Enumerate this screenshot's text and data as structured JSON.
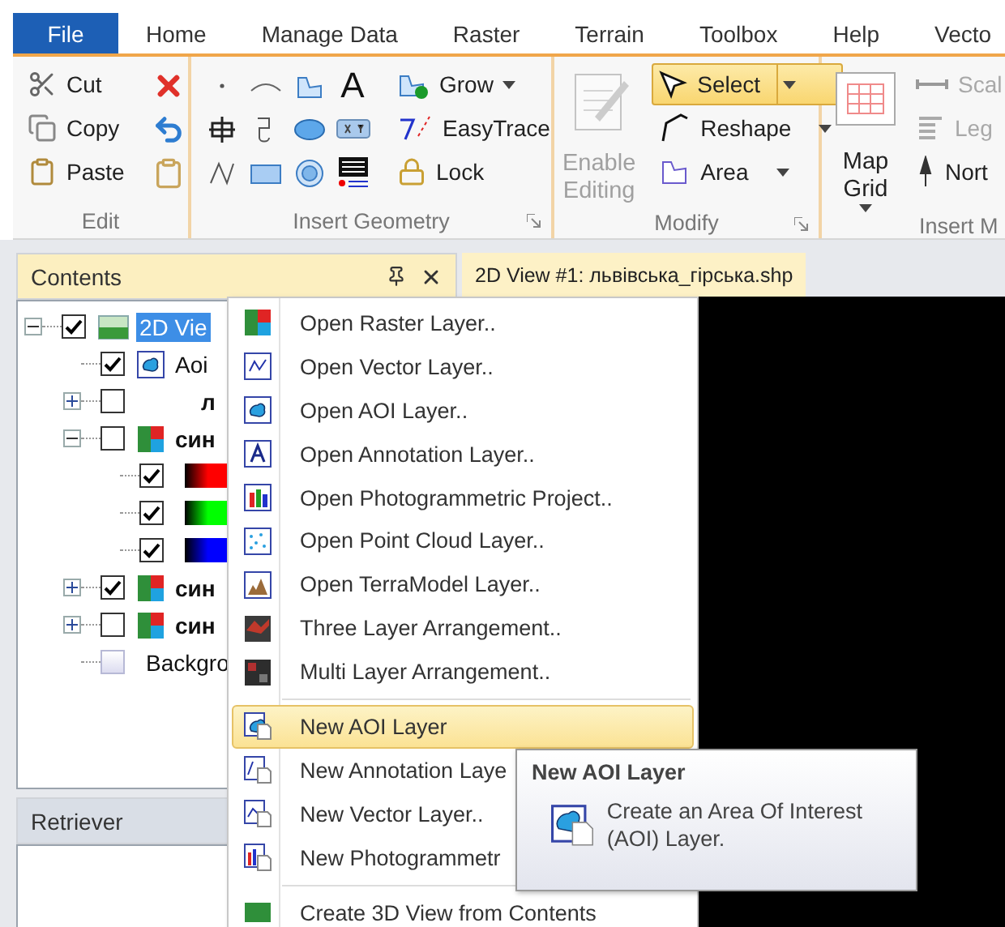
{
  "menu_tabs": [
    {
      "label": "File",
      "selected": true
    },
    {
      "label": "Home",
      "selected": false
    },
    {
      "label": "Manage Data",
      "selected": false
    },
    {
      "label": "Raster",
      "selected": false
    },
    {
      "label": "Terrain",
      "selected": false
    },
    {
      "label": "Toolbox",
      "selected": false
    },
    {
      "label": "Help",
      "selected": false
    },
    {
      "label": "Vecto",
      "selected": false
    }
  ],
  "ribbon": {
    "groups": [
      {
        "kind": "edit",
        "label": "Edit",
        "items": [
          {
            "label": "Cut"
          },
          {
            "label": "Copy"
          },
          {
            "label": "Paste"
          }
        ]
      },
      {
        "kind": "geometry",
        "label": "Insert Geometry",
        "glyph": "A",
        "items": [
          {
            "label": "Grow",
            "dropdown": true
          },
          {
            "label": "EasyTrace",
            "dropdown": false
          },
          {
            "label": "Lock",
            "dropdown": false
          }
        ]
      },
      {
        "kind": "modify",
        "label": "Modify",
        "edit_button": {
          "label": "Enable Editing",
          "disabled": true
        },
        "items": [
          {
            "label": "Select",
            "selected": true,
            "dropdown": true
          },
          {
            "label": "Reshape",
            "selected": false,
            "dropdown": true
          },
          {
            "label": "Area",
            "selected": false,
            "dropdown": true
          }
        ]
      },
      {
        "kind": "insert_map",
        "label": "Insert M",
        "map_grid": {
          "label": "Map Grid"
        },
        "items": [
          {
            "label": "Scal",
            "disabled": true
          },
          {
            "label": "Leg",
            "disabled": true
          },
          {
            "label": "Nort",
            "disabled": false
          }
        ]
      }
    ]
  },
  "contents_panel": {
    "title": "Contents",
    "tree": [
      {
        "kind": "view",
        "label": "2D Vie",
        "checked": true,
        "selected": true,
        "expanded": true,
        "children": [
          {
            "kind": "aoi",
            "label": "Aoi",
            "checked": true,
            "selected": false
          },
          {
            "kind": "plain",
            "label": "л",
            "checked": false,
            "selected": false,
            "expanded": false
          },
          {
            "kind": "raster",
            "label": "син",
            "checked": false,
            "selected": false,
            "expanded": true,
            "children": [
              {
                "kind": "band",
                "color": "#ff0000",
                "checked": true,
                "selected": false
              },
              {
                "kind": "band",
                "color": "#00ff00",
                "checked": true,
                "selected": false
              },
              {
                "kind": "band",
                "color": "#0000ff",
                "checked": true,
                "selected": false
              }
            ]
          },
          {
            "kind": "raster",
            "label": "син",
            "checked": true,
            "selected": false,
            "expanded": false
          },
          {
            "kind": "raster",
            "label": "син",
            "checked": false,
            "selected": false,
            "expanded": false
          },
          {
            "kind": "background",
            "label": "Backgro",
            "checked": false,
            "selected": false
          }
        ]
      }
    ]
  },
  "retriever_panel": {
    "title": "Retriever"
  },
  "view": {
    "tab": "2D View #1: львівська_гірська.shp"
  },
  "context_menu": {
    "items": [
      {
        "kind": "item",
        "label": "Open Raster Layer..",
        "selected": false
      },
      {
        "kind": "item",
        "label": "Open Vector Layer..",
        "selected": false
      },
      {
        "kind": "item",
        "label": "Open AOI Layer..",
        "selected": false
      },
      {
        "kind": "item",
        "label": "Open Annotation Layer..",
        "selected": false
      },
      {
        "kind": "item",
        "label": "Open Photogrammetric Project..",
        "selected": false
      },
      {
        "kind": "item",
        "label": "Open Point Cloud Layer..",
        "selected": false
      },
      {
        "kind": "item",
        "label": "Open TerraModel Layer..",
        "selected": false
      },
      {
        "kind": "item",
        "label": "Three Layer Arrangement..",
        "selected": false
      },
      {
        "kind": "item",
        "label": "Multi Layer Arrangement..",
        "selected": false
      },
      {
        "kind": "separator"
      },
      {
        "kind": "item",
        "label": "New AOI Layer",
        "selected": true
      },
      {
        "kind": "item",
        "label": "New Annotation Laye",
        "selected": false
      },
      {
        "kind": "item",
        "label": "New Vector Layer..",
        "selected": false
      },
      {
        "kind": "item",
        "label": "New Photogrammetr",
        "selected": false
      },
      {
        "kind": "separator"
      },
      {
        "kind": "item",
        "label": "Create 3D View from Contents",
        "selected": false
      }
    ]
  },
  "tooltip": {
    "title": "New AOI Layer",
    "text": "Create an Area Of Interest (AOI) Layer."
  }
}
